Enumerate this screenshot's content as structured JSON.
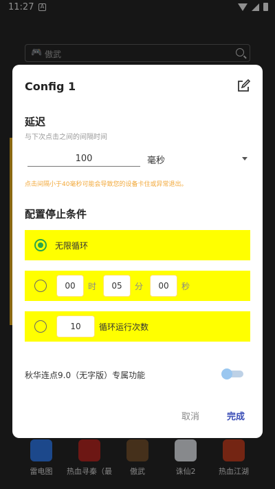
{
  "status_bar": {
    "time": "11:27",
    "notification_icon": "a-icon"
  },
  "background": {
    "search": {
      "placeholder": "傲武",
      "gamepad_icon": "🎮"
    },
    "dock_apps": [
      {
        "label": "雷电图",
        "color": "#2b6fd6"
      },
      {
        "label": "热血寻秦（最",
        "color": "#a8241f"
      },
      {
        "label": "傲武",
        "color": "#6b4a2a"
      },
      {
        "label": "诛仙2",
        "color": "#cfd3d8"
      },
      {
        "label": "热血江湖",
        "color": "#b33a1e"
      }
    ]
  },
  "dialog": {
    "title": "Config 1",
    "delay": {
      "title": "延迟",
      "subtitle": "与下次点击之间的间隔时间",
      "value": "100",
      "unit": "毫秒",
      "warning": "点击间隔小于40毫秒可能会导致您的设备卡住或异常退出。"
    },
    "stop_condition": {
      "title": "配置停止条件",
      "options": {
        "infinite": {
          "label": "无限循环",
          "selected": true
        },
        "timed": {
          "hours": "00",
          "hours_unit": "时",
          "minutes": "05",
          "minutes_unit": "分",
          "seconds": "00",
          "seconds_unit": "秒",
          "selected": false
        },
        "count": {
          "value": "10",
          "label": "循环运行次数",
          "selected": false
        }
      }
    },
    "feature": {
      "label": "秋华连点9.0（无字版）专属功能",
      "enabled": false
    },
    "buttons": {
      "cancel": "取消",
      "done": "完成"
    }
  },
  "colors": {
    "highlight": "#ffff00",
    "accent_green": "#2aa64a",
    "warning": "#f2a93b",
    "primary": "#3a4db6"
  }
}
